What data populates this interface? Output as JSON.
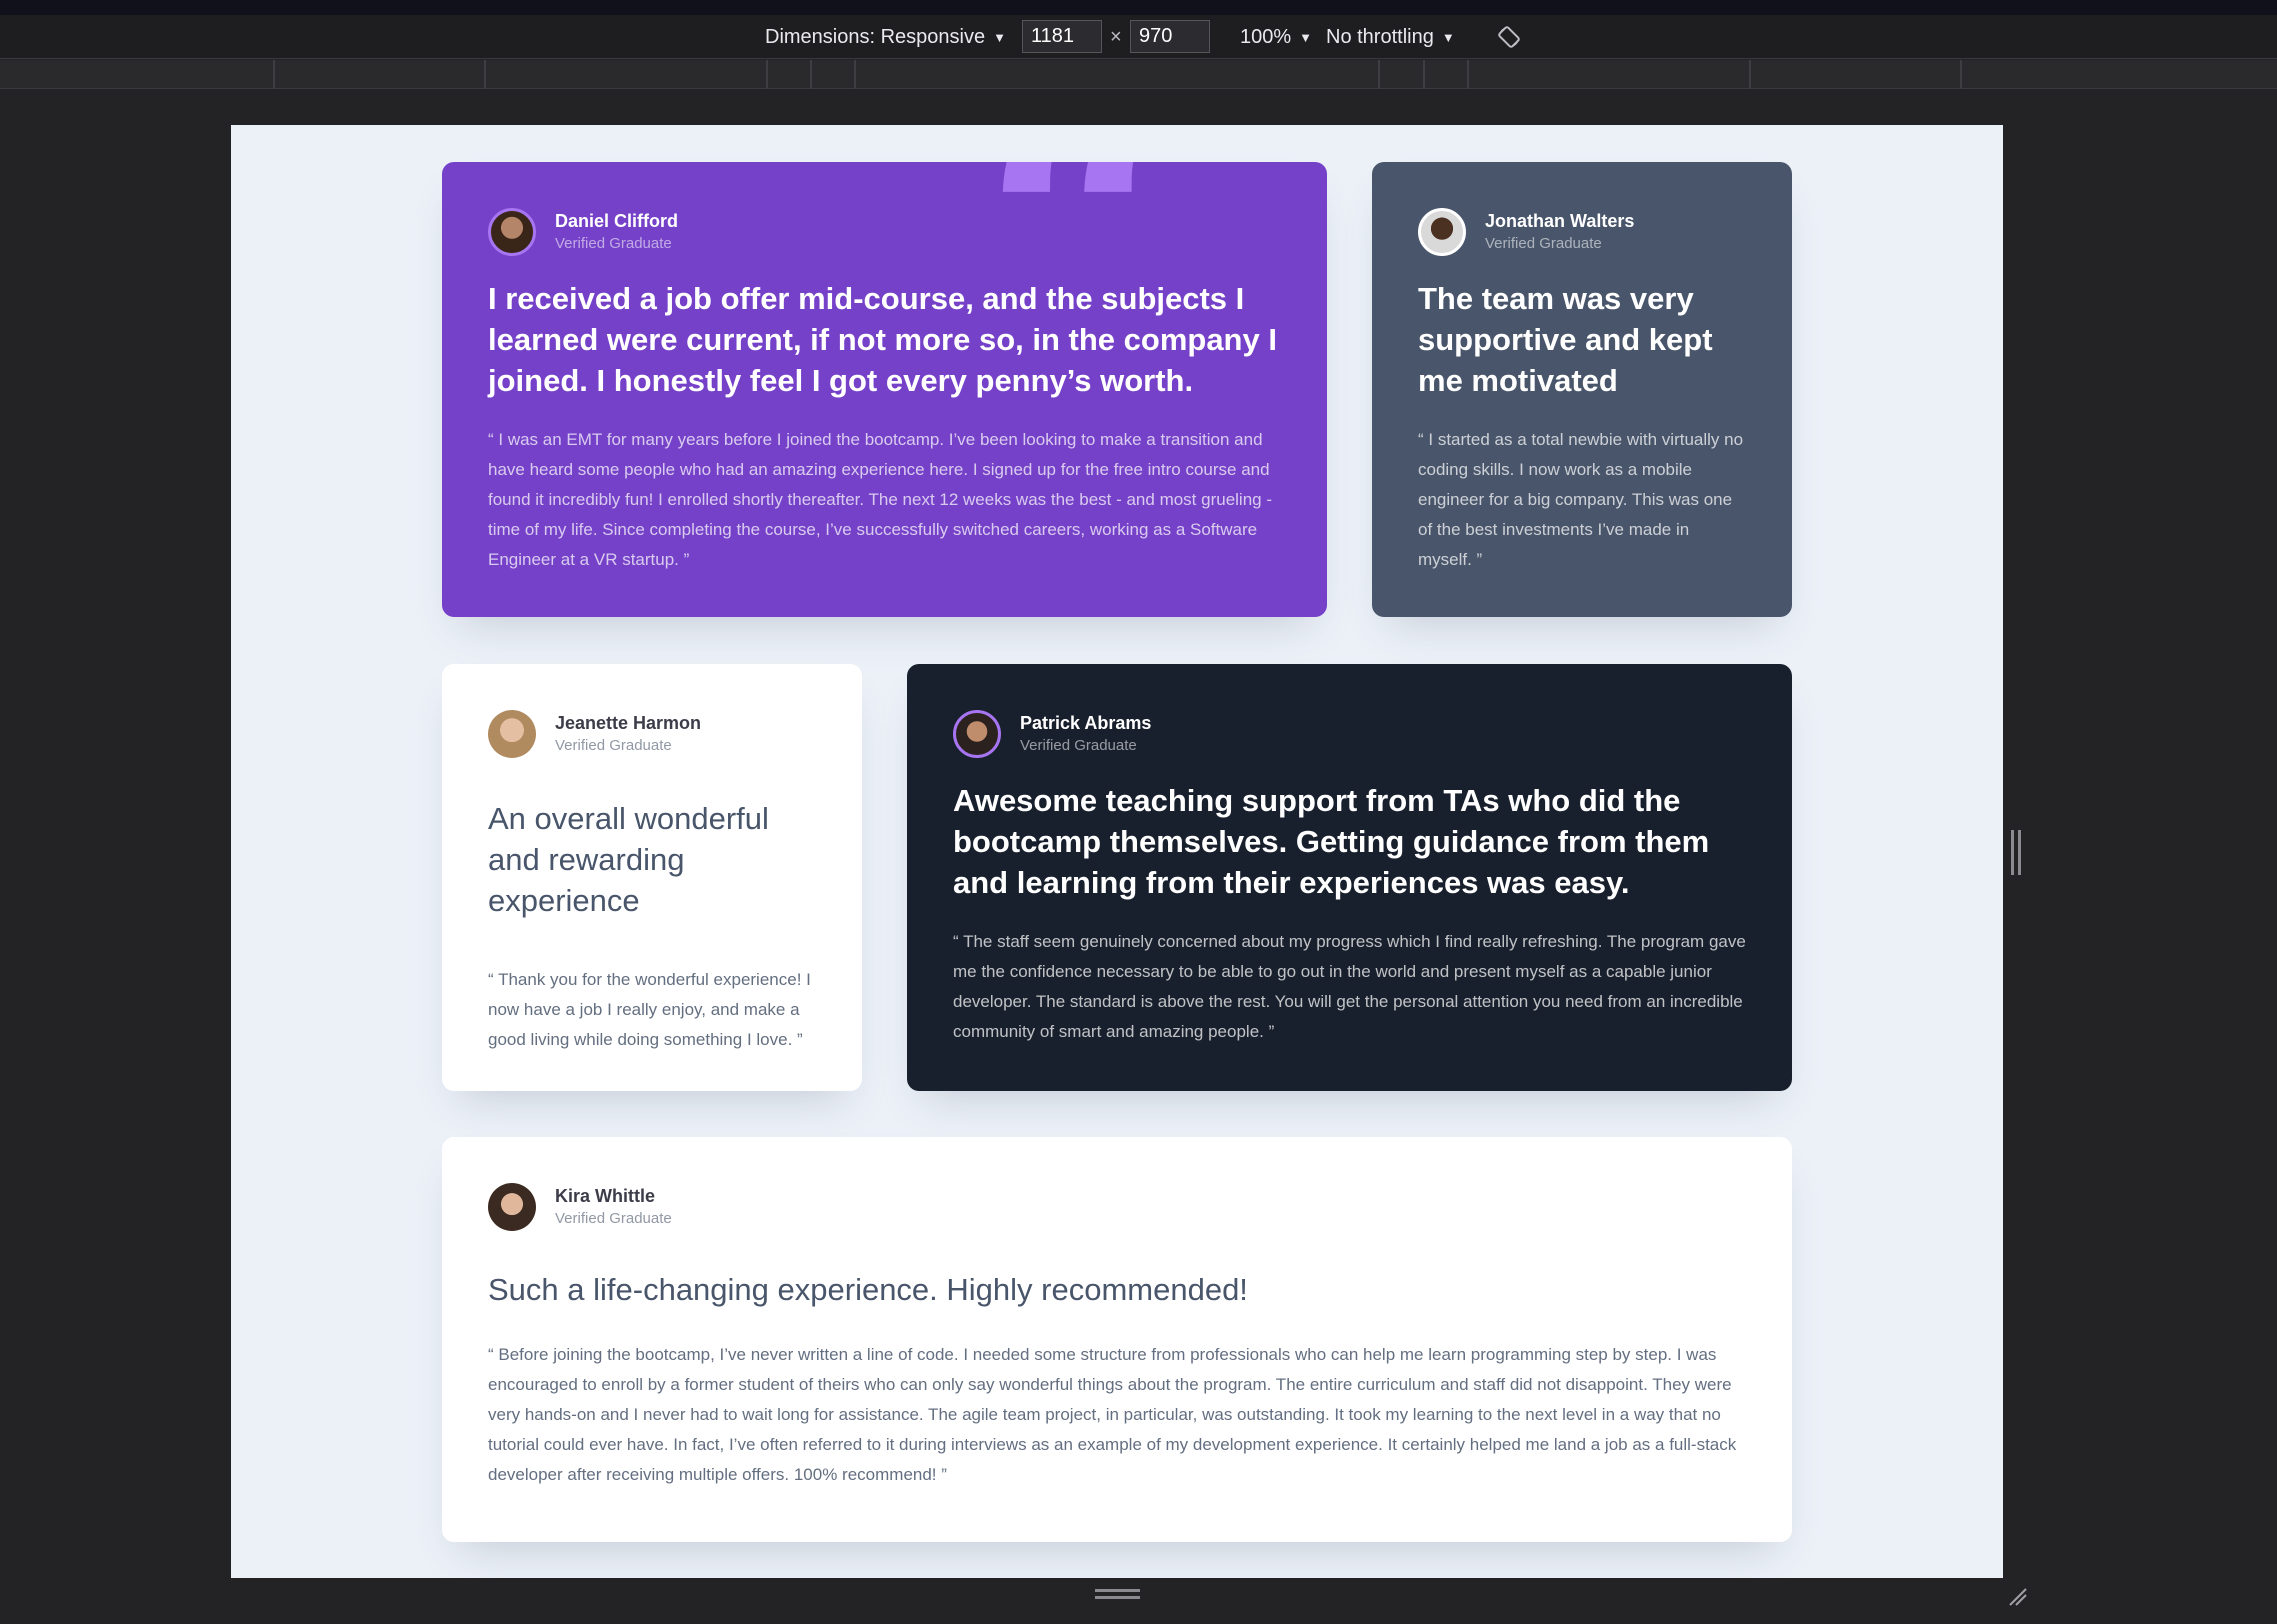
{
  "devtools": {
    "dimensions_label": "Dimensions: Responsive",
    "width_value": "1181",
    "times_sign": "×",
    "height_value": "970",
    "zoom_label": "100%",
    "throttle_label": "No throttling",
    "caret": "▼"
  },
  "colors": {
    "purple": "#7541c8",
    "slate": "#48556a",
    "dark": "#19202d",
    "page_bg": "#ecf1f8"
  },
  "testimonials": [
    {
      "name": "Daniel Clifford",
      "role": "Verified Graduate",
      "headline": "I received a job offer mid-course, and the subjects I learned were current, if not more so, in the company I joined. I honestly feel I got every penny’s worth.",
      "body": "“ I was an EMT for many years before I joined the bootcamp. I’ve been looking to make a transition and have heard some people who had an amazing experience here. I signed up for the free intro course and found it incredibly fun! I enrolled shortly thereafter. The next 12 weeks was the best - and most grueling - time of my life. Since completing the course, I’ve successfully switched careers, working as a Software Engineer at a VR startup. ”"
    },
    {
      "name": "Jonathan Walters",
      "role": "Verified Graduate",
      "headline": "The team was very supportive and kept me motivated",
      "body": "“ I started as a total newbie with virtually no coding skills. I now work as a mobile engineer for a big company. This was one of the best investments I’ve made in myself. ”"
    },
    {
      "name": "Jeanette Harmon",
      "role": "Verified Graduate",
      "headline": "An overall wonderful and rewarding experience",
      "body": "“ Thank you for the wonderful experience! I now have a job I really enjoy, and make a good living while doing something I love. ”"
    },
    {
      "name": "Patrick Abrams",
      "role": "Verified Graduate",
      "headline": "Awesome teaching support from TAs who did the bootcamp themselves. Getting guidance from them and learning from their experiences was easy.",
      "body": "“ The staff seem genuinely concerned about my progress which I find really refreshing. The program gave me the confidence necessary to be able to go out in the world and present myself as a capable junior developer. The standard is above the rest. You will get the personal attention you need from an incredible community of smart and amazing people. ”"
    },
    {
      "name": "Kira Whittle",
      "role": "Verified Graduate",
      "headline": "Such a life-changing experience. Highly recommended!",
      "body": "“ Before joining the bootcamp, I’ve never written a line of code. I needed some structure from professionals who can help me learn programming step by step. I was encouraged to enroll by a former student of theirs who can only say wonderful things about the program. The entire curriculum and staff did not disappoint. They were very hands-on and I never had to wait long for assistance. The agile team project, in particular, was outstanding. It took my learning to the next level in a way that no tutorial could ever have. In fact, I’ve often referred to it during interviews as an example of my development experience. It certainly helped me land a job as a full-stack developer after receiving multiple offers. 100% recommend! ”"
    }
  ]
}
